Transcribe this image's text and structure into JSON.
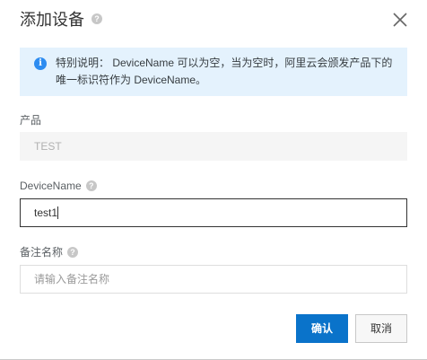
{
  "dialog": {
    "title": "添加设备",
    "help_glyph": "?",
    "close_glyph": "×"
  },
  "notice": {
    "icon_glyph": "i",
    "text": "特别说明： DeviceName 可以为空，当为空时，阿里云会颁发产品下的唯一标识符作为 DeviceName。"
  },
  "form": {
    "product": {
      "label": "产品",
      "value": "TEST"
    },
    "device_name": {
      "label": "DeviceName",
      "value": "test1"
    },
    "remark": {
      "label": "备注名称",
      "placeholder": "请输入备注名称"
    }
  },
  "footer": {
    "confirm_label": "确认",
    "cancel_label": "取消"
  },
  "colors": {
    "primary": "#0a73ca",
    "notice_bg": "#e4f2fd",
    "info_icon": "#2d8cf0"
  }
}
